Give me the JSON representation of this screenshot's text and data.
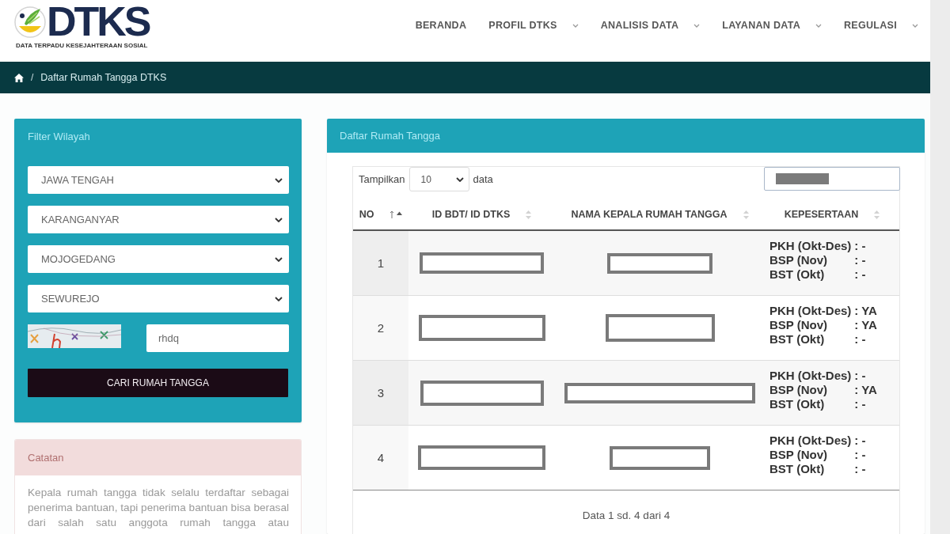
{
  "header": {
    "logo": {
      "wordmark": "DTKS",
      "tagline": "DATA TERPADU KESEJAHTERAAN SOSIAL"
    },
    "nav": [
      {
        "label": "BERANDA",
        "dropdown": false
      },
      {
        "label": "PROFIL DTKS",
        "dropdown": true
      },
      {
        "label": "ANALISIS DATA",
        "dropdown": true
      },
      {
        "label": "LAYANAN DATA",
        "dropdown": true
      },
      {
        "label": "REGULASI",
        "dropdown": true
      }
    ]
  },
  "breadcrumb": {
    "separator": "/",
    "current": "Daftar Rumah Tangga DTKS"
  },
  "filter_panel": {
    "title": "Filter Wilayah",
    "selects": [
      {
        "value": "JAWA TENGAH"
      },
      {
        "value": "KARANGANYAR"
      },
      {
        "value": "MOJOGEDANG"
      },
      {
        "value": "SEWUREJO"
      }
    ],
    "captcha_input": {
      "value": "rhdq"
    },
    "button": "CARI RUMAH TANGGA"
  },
  "note_panel": {
    "title": "Catatan",
    "text": "Kepala rumah tangga tidak selalu terdaftar sebagai penerima bantuan, tapi penerima bantuan bisa berasal dari salah satu anggota rumah tangga atau"
  },
  "table_panel": {
    "title": "Daftar Rumah Tangga",
    "length_label": "Tampilkan",
    "length_value": "10",
    "length_suffix": "data",
    "search": {
      "redacted": true
    },
    "columns": [
      {
        "label": "NO",
        "sorted": true
      },
      {
        "label": "ID BDT/ ID DTKS",
        "sorted": false
      },
      {
        "label": "NAMA KEPALA RUMAH TANGGA",
        "sorted": false
      },
      {
        "label": "KEPESERTAAN",
        "sorted": false
      }
    ],
    "rows": [
      {
        "no": "1",
        "id_redacted": true,
        "name_redacted": true,
        "programs": [
          {
            "label": "PKH (Okt-Des)",
            "value": ": -"
          },
          {
            "label": "BSP (Nov)",
            "value": ": -"
          },
          {
            "label": "BST (Okt)",
            "value": ": -"
          }
        ]
      },
      {
        "no": "2",
        "id_redacted": true,
        "name_redacted": true,
        "programs": [
          {
            "label": "PKH (Okt-Des)",
            "value": ": YA"
          },
          {
            "label": "BSP (Nov)",
            "value": ": YA"
          },
          {
            "label": "BST (Okt)",
            "value": ": -"
          }
        ]
      },
      {
        "no": "3",
        "id_redacted": true,
        "name_redacted": true,
        "programs": [
          {
            "label": "PKH (Okt-Des)",
            "value": ": -"
          },
          {
            "label": "BSP (Nov)",
            "value": ": YA"
          },
          {
            "label": "BST (Okt)",
            "value": ": -"
          }
        ]
      },
      {
        "no": "4",
        "id_redacted": true,
        "name_redacted": true,
        "programs": [
          {
            "label": "PKH (Okt-Des)",
            "value": ": -"
          },
          {
            "label": "BSP (Nov)",
            "value": ": -"
          },
          {
            "label": "BST (Okt)",
            "value": ": -"
          }
        ]
      }
    ],
    "info": "Data 1 sd. 4 dari 4"
  }
}
